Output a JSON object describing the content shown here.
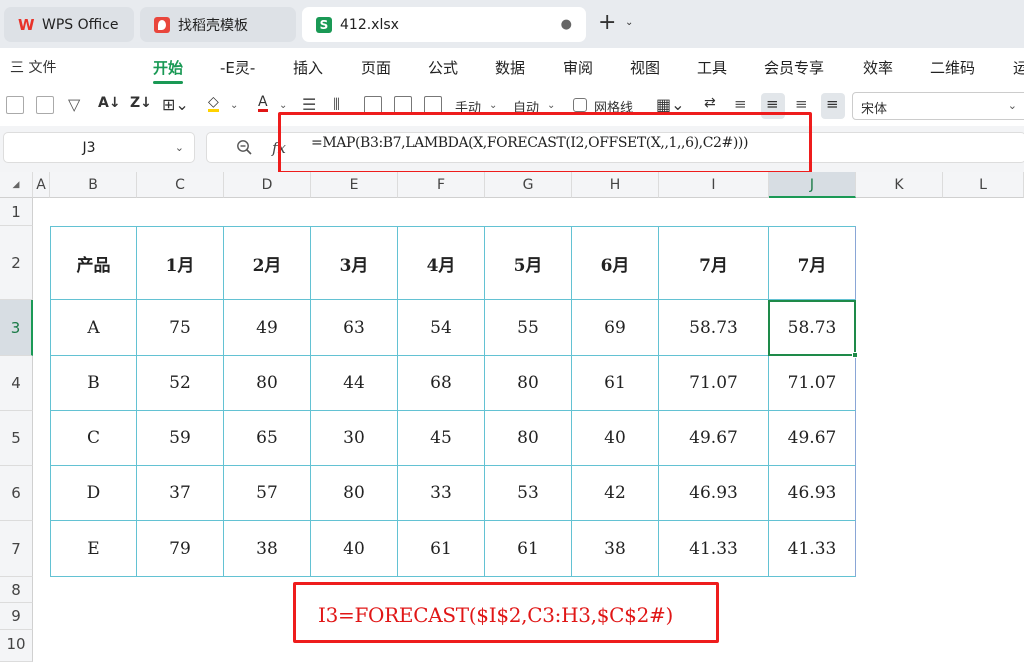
{
  "tabs": [
    {
      "label": "WPS Office"
    },
    {
      "label": "找稻壳模板"
    },
    {
      "label": "412.xlsx",
      "close": "●"
    }
  ],
  "menu": {
    "file_label": "三 文件",
    "items": [
      "开始",
      "-E灵-",
      "插入",
      "页面",
      "公式",
      "数据",
      "审阅",
      "视图",
      "工具",
      "会员专享",
      "效率",
      "二维码",
      "运"
    ],
    "active": "开始"
  },
  "toolbar": {
    "manual_label": "手动",
    "auto_label": "自动",
    "gridlines_label": "网格线",
    "font_name": "宋体"
  },
  "formula_bar": {
    "cell_ref": "J3",
    "fx": "fx",
    "formula": "=MAP(B3:B7,LAMBDA(X,FORECAST(I2,OFFSET(X,,1,,6),C2#)))"
  },
  "columns": [
    "A",
    "B",
    "C",
    "D",
    "E",
    "F",
    "G",
    "H",
    "I",
    "J",
    "K",
    "L"
  ],
  "selected_column": "J",
  "rows": [
    "1",
    "2",
    "3",
    "4",
    "5",
    "6",
    "7",
    "8",
    "9",
    "10"
  ],
  "selected_row": "3",
  "table": {
    "header": [
      "产品",
      "1月",
      "2月",
      "3月",
      "4月",
      "5月",
      "6月",
      "7月",
      "7月"
    ],
    "rows": [
      [
        "A",
        "75",
        "49",
        "63",
        "54",
        "55",
        "69",
        "58.73",
        "58.73"
      ],
      [
        "B",
        "52",
        "80",
        "44",
        "68",
        "80",
        "61",
        "71.07",
        "71.07"
      ],
      [
        "C",
        "59",
        "65",
        "30",
        "45",
        "80",
        "40",
        "49.67",
        "49.67"
      ],
      [
        "D",
        "37",
        "57",
        "80",
        "33",
        "53",
        "42",
        "46.93",
        "46.93"
      ],
      [
        "E",
        "79",
        "38",
        "40",
        "61",
        "61",
        "38",
        "41.33",
        "41.33"
      ]
    ]
  },
  "annotation": "I3=FORECAST($I$2,C3:H3,$C$2#)",
  "colors": {
    "accent": "#1a9955",
    "table_border": "#63c2d3",
    "highlight_red": "#ee1c1c"
  }
}
